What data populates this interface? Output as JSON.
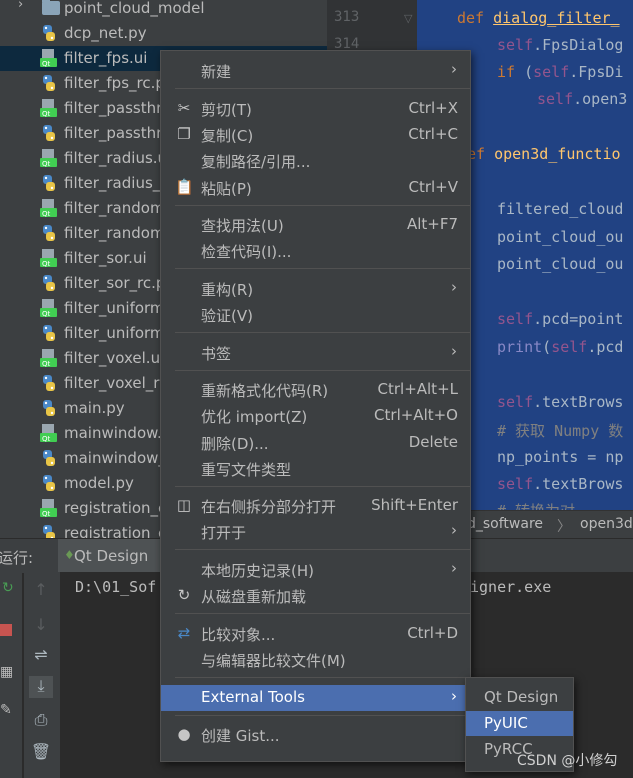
{
  "project_tree": {
    "folder": "point_cloud_model",
    "files": [
      {
        "name": "dcp_net.py",
        "kind": "py"
      },
      {
        "name": "filter_fps.ui",
        "kind": "ui",
        "selected": true
      },
      {
        "name": "filter_fps_rc.p",
        "kind": "py"
      },
      {
        "name": "filter_passthr",
        "kind": "ui"
      },
      {
        "name": "filter_passthr",
        "kind": "py"
      },
      {
        "name": "filter_radius.u",
        "kind": "ui"
      },
      {
        "name": "filter_radius_u",
        "kind": "py"
      },
      {
        "name": "filter_random",
        "kind": "ui"
      },
      {
        "name": "filter_random",
        "kind": "py"
      },
      {
        "name": "filter_sor.ui",
        "kind": "ui"
      },
      {
        "name": "filter_sor_rc.p",
        "kind": "py"
      },
      {
        "name": "filter_uniform",
        "kind": "ui"
      },
      {
        "name": "filter_uniform",
        "kind": "py"
      },
      {
        "name": "filter_voxel.ui",
        "kind": "ui"
      },
      {
        "name": "filter_voxel_r",
        "kind": "py"
      },
      {
        "name": "main.py",
        "kind": "py"
      },
      {
        "name": "mainwindow.",
        "kind": "ui"
      },
      {
        "name": "mainwindow_",
        "kind": "py"
      },
      {
        "name": "model.py",
        "kind": "py"
      },
      {
        "name": "registration_c",
        "kind": "ui"
      },
      {
        "name": "registration_c",
        "kind": "py"
      }
    ]
  },
  "gutter": {
    "line_313": "313",
    "line_314": "314"
  },
  "code": {
    "l1_kw": "def",
    "l1_fn": "dialog_filter_",
    "l2_self": "self",
    "l2_rest": ".FpsDialog",
    "l3_kw": "if",
    "l3_a": " (",
    "l3_self": "self",
    "l3_rest": ".FpsDi",
    "l4_self": "self",
    "l4_rest": ".open3",
    "l5_kw": "ef",
    "l5_fn": "open3d_functio",
    "l6": "filtered_cloud",
    "l7": "point_cloud_ou",
    "l8": "point_cloud_ou",
    "l9_self": "self",
    "l9_rest": ".pcd=point",
    "l10_fn": "print",
    "l10_a": "(",
    "l10_self": "self",
    "l10_rest": ".pcd",
    "l11_self": "self",
    "l11_rest": ".textBrows",
    "l12": "# 获取 Numpy 数",
    "l13": "np_points = np",
    "l14_self": "self",
    "l14_rest": ".textBrows",
    "l15": "# 转换为对"
  },
  "breadcrumb": {
    "item1": "d_software",
    "sep": "〉",
    "item2": "open3d"
  },
  "run_panel": {
    "label": "运行:",
    "tab": "Qt Design",
    "console_left": "D:\\01_Sof",
    "console_right": "igner.exe"
  },
  "context_menu": {
    "new": "新建",
    "cut": "剪切(T)",
    "cut_sc": "Ctrl+X",
    "copy": "复制(C)",
    "copy_sc": "Ctrl+C",
    "copy_path": "复制路径/引用...",
    "paste": "粘贴(P)",
    "paste_sc": "Ctrl+V",
    "find_usages": "查找用法(U)",
    "find_usages_sc": "Alt+F7",
    "inspect": "检查代码(I)...",
    "refactor": "重构(R)",
    "validate": "验证(V)",
    "bookmarks": "书签",
    "reformat": "重新格式化代码(R)",
    "reformat_sc": "Ctrl+Alt+L",
    "optimize_imports": "优化 import(Z)",
    "optimize_imports_sc": "Ctrl+Alt+O",
    "delete": "删除(D)...",
    "delete_sc": "Delete",
    "override_type": "重写文件类型",
    "split_open": "在右侧拆分部分打开",
    "split_open_sc": "Shift+Enter",
    "open_in": "打开于",
    "local_history": "本地历史记录(H)",
    "reload": "从磁盘重新加载",
    "compare_with": "比较对象...",
    "compare_with_sc": "Ctrl+D",
    "compare_editor": "与编辑器比较文件(M)",
    "external_tools": "External Tools",
    "create_gist": "创建 Gist..."
  },
  "submenu": {
    "items": [
      "Qt Design",
      "PyUIC",
      "PyRCC"
    ],
    "highlighted": "PyUIC"
  },
  "watermark": "CSDN @小修勾",
  "colors": {
    "highlight": "#4b6eaf",
    "selection": "#214283",
    "menu_bg": "#3c3f41"
  }
}
